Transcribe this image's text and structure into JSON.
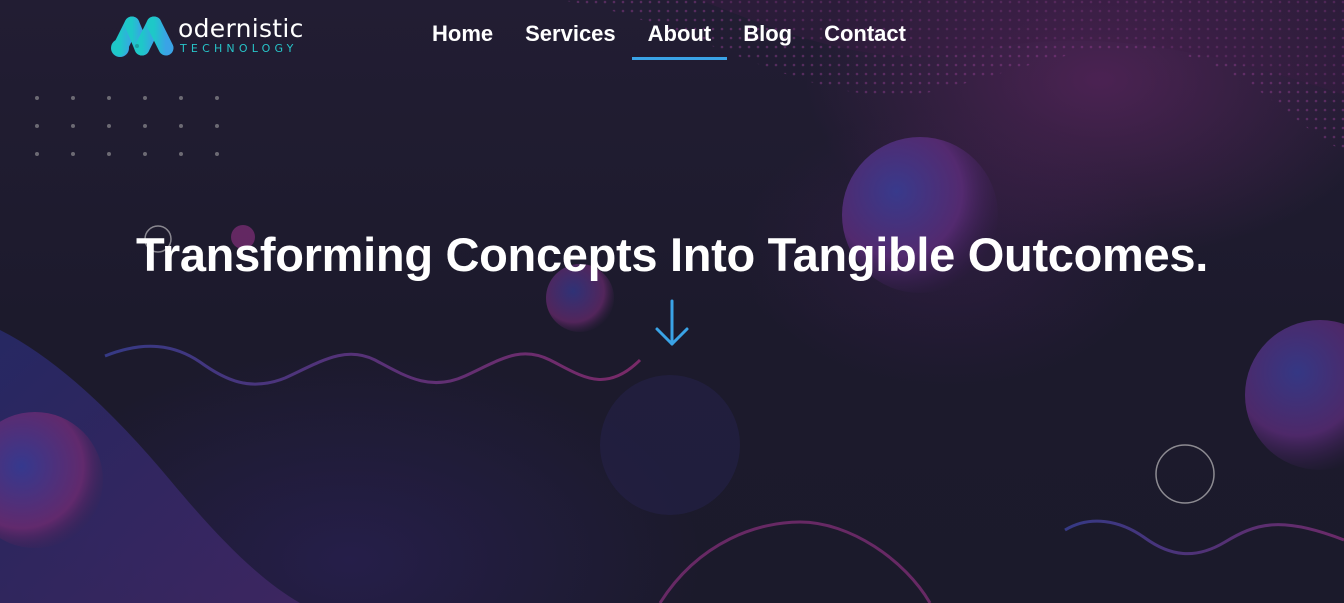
{
  "brand": {
    "logo_text": "odernistic",
    "logo_subtext": "TECHNOLOGY",
    "logo_mark_icon": "stylized-m-icon",
    "mark_colors": [
      "#1ec8c8",
      "#3aa3e6"
    ]
  },
  "nav": {
    "items": [
      {
        "label": "Home"
      },
      {
        "label": "Services"
      },
      {
        "label": "About"
      },
      {
        "label": "Blog"
      },
      {
        "label": "Contact"
      }
    ],
    "active": "About"
  },
  "hero": {
    "headline": "Transforming Concepts Into Tangible Outcomes.",
    "scroll_icon": "arrow-down-icon"
  },
  "colors": {
    "background": "#1d1a2e",
    "accent": "#3aa3e6",
    "brand_teal": "#27c3c8",
    "text": "#ffffff",
    "decor_wave": "#3b3a85",
    "decor_magenta": "#a02f7a"
  }
}
